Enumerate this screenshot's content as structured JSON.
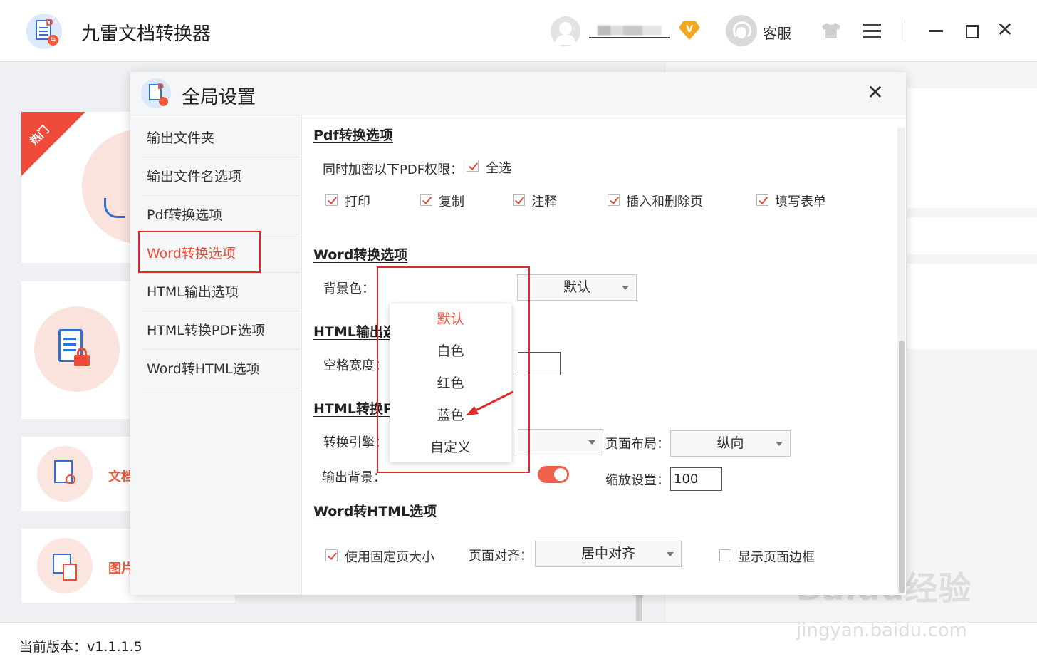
{
  "app": {
    "title": "九雷文档转换器",
    "support_label": "客服",
    "vip_badge": "V"
  },
  "background": {
    "hot_tag": "热门",
    "cards": [
      {
        "label": "文档"
      },
      {
        "label": "图片"
      }
    ],
    "version_label": "当前版本：v1.1.1.5"
  },
  "watermark": {
    "main": "Baidu经验",
    "sub": "jingyan.baidu.com"
  },
  "dialog": {
    "title": "全局设置",
    "nav": [
      {
        "label": "输出文件夹"
      },
      {
        "label": "输出文件名选项"
      },
      {
        "label": "Pdf转换选项"
      },
      {
        "label": "Word转换选项",
        "active": true
      },
      {
        "label": "HTML输出选项"
      },
      {
        "label": "HTML转换PDF选项"
      },
      {
        "label": "Word转HTML选项"
      }
    ],
    "pdf": {
      "title": "Pdf转换选项",
      "encrypt_label": "同时加密以下PDF权限：",
      "select_all": "全选",
      "perms": [
        "打印",
        "复制",
        "注释",
        "插入和删除页",
        "填写表单"
      ]
    },
    "word": {
      "title": "Word转换选项",
      "bg_label": "背景色：",
      "bg_value": "默认",
      "options": [
        "默认",
        "白色",
        "红色",
        "蓝色",
        "自定义"
      ],
      "selected_option": "默认"
    },
    "html_out": {
      "title": "HTML输出选项",
      "space_label": "空格宽度："
    },
    "html_pdf": {
      "title": "HTML转换PDF选项",
      "engine_label": "转换引擎：",
      "bg_label": "输出背景：",
      "layout_label": "页面布局：",
      "layout_value": "纵向",
      "zoom_label": "缩放设置：",
      "zoom_value": "100"
    },
    "word_html": {
      "title": "Word转HTML选项",
      "fixed_size_label": "使用固定页大小",
      "align_label": "页面对齐：",
      "align_value": "居中对齐",
      "border_label": "显示页面边框"
    }
  },
  "colors": {
    "accent": "#ee4b3a",
    "highlight_box": "#e02a27",
    "brand_blue": "#2f6fd6"
  }
}
